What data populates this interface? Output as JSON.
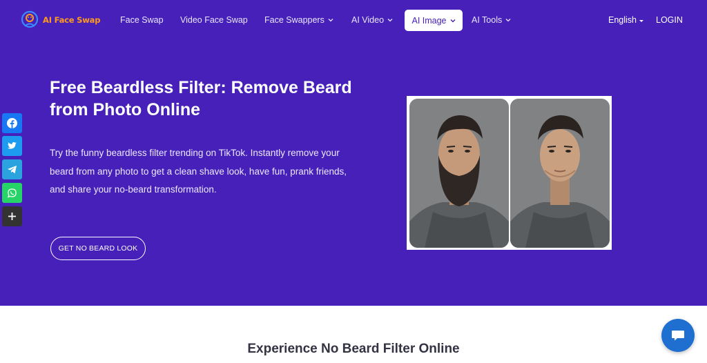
{
  "brand": {
    "name": "AI Face Swap",
    "logo_color": "#ff9a1f"
  },
  "colors": {
    "hero_bg": "#4620b8",
    "accent": "#4620b8",
    "chat": "#1f6fd0"
  },
  "nav": {
    "items": [
      {
        "label": "Face Swap",
        "dropdown": false
      },
      {
        "label": "Video Face Swap",
        "dropdown": false
      },
      {
        "label": "Face Swappers",
        "dropdown": true
      },
      {
        "label": "AI Video",
        "dropdown": true
      },
      {
        "label": "AI Image",
        "dropdown": true,
        "active": true
      },
      {
        "label": "AI Tools",
        "dropdown": true
      }
    ],
    "language": "English",
    "login": "LOGIN"
  },
  "hero": {
    "title": "Free Beardless Filter: Remove Beard from Photo Online",
    "description": "Try the funny beardless filter trending on TikTok. Instantly remove your beard from any photo to get a clean shave look, have fun, prank friends, and share your no-beard transformation.",
    "cta": "GET NO BEARD LOOK",
    "images": [
      "man-with-beard-before",
      "man-without-beard-after"
    ]
  },
  "social": [
    {
      "name": "facebook-icon",
      "color": "#1877f2"
    },
    {
      "name": "twitter-icon",
      "color": "#1d9bf0"
    },
    {
      "name": "telegram-icon",
      "color": "#2aa3df"
    },
    {
      "name": "whatsapp-icon",
      "color": "#25d366"
    },
    {
      "name": "more-icon",
      "color": "#333333"
    }
  ],
  "section": {
    "title": "Experience No Beard Filter Online"
  },
  "chat": {
    "icon": "chat-bubble-icon"
  }
}
